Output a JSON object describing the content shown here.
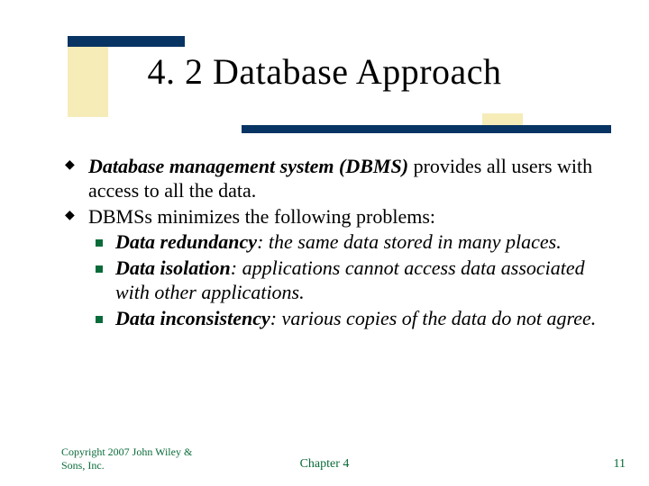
{
  "title": "4. 2 Database Approach",
  "bullets": [
    {
      "lead_bi": "Database management system (DBMS)",
      "rest": " provides all users with access to all the data."
    },
    {
      "text": "DBMSs minimizes the following problems:",
      "sub": [
        {
          "term": "Data redundancy",
          "desc": ": the same data stored in many places."
        },
        {
          "term": "Data isolation",
          "desc": ": applications cannot access data associated with other applications."
        },
        {
          "term": "Data inconsistency",
          "desc": ": various copies of the data do not agree."
        }
      ]
    }
  ],
  "footer": {
    "copyright": "Copyright 2007 John Wiley & Sons, Inc.",
    "chapter": "Chapter 4",
    "page": "11"
  }
}
